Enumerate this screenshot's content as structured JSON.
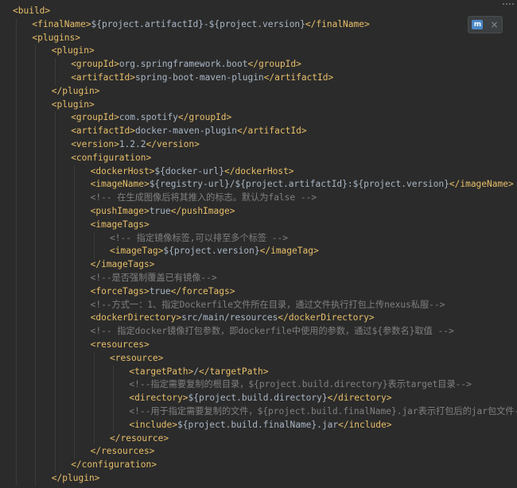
{
  "toolbar": {
    "maven_icon": "maven-reload-icon",
    "close_icon": "close-icon"
  },
  "code_lines": [
    {
      "indent": 0,
      "parts": [
        {
          "t": "tag",
          "v": "<build>"
        }
      ]
    },
    {
      "indent": 1,
      "parts": [
        {
          "t": "tag",
          "v": "<finalName>"
        },
        {
          "t": "txt",
          "v": "${project.artifactId}-${project.version}"
        },
        {
          "t": "tag",
          "v": "</finalName>"
        }
      ]
    },
    {
      "indent": 1,
      "parts": [
        {
          "t": "tag",
          "v": "<plugins>"
        }
      ]
    },
    {
      "indent": 2,
      "parts": [
        {
          "t": "tag",
          "v": "<plugin>"
        }
      ]
    },
    {
      "indent": 3,
      "parts": [
        {
          "t": "tag",
          "v": "<groupId>"
        },
        {
          "t": "txt",
          "v": "org.springframework.boot"
        },
        {
          "t": "tag",
          "v": "</groupId>"
        }
      ]
    },
    {
      "indent": 3,
      "parts": [
        {
          "t": "tag",
          "v": "<artifactId>"
        },
        {
          "t": "txt",
          "v": "spring-boot-maven-plugin"
        },
        {
          "t": "tag",
          "v": "</artifactId>"
        }
      ]
    },
    {
      "indent": 2,
      "parts": [
        {
          "t": "tag",
          "v": "</plugin>"
        }
      ]
    },
    {
      "indent": 2,
      "parts": [
        {
          "t": "tag",
          "v": "<plugin>"
        }
      ]
    },
    {
      "indent": 3,
      "parts": [
        {
          "t": "tag",
          "v": "<groupId>"
        },
        {
          "t": "txt",
          "v": "com.spotify"
        },
        {
          "t": "tag",
          "v": "</groupId>"
        }
      ]
    },
    {
      "indent": 3,
      "parts": [
        {
          "t": "tag",
          "v": "<artifactId>"
        },
        {
          "t": "txt",
          "v": "docker-maven-plugin"
        },
        {
          "t": "tag",
          "v": "</artifactId>"
        }
      ]
    },
    {
      "indent": 3,
      "parts": [
        {
          "t": "tag",
          "v": "<version>"
        },
        {
          "t": "txt",
          "v": "1.2.2"
        },
        {
          "t": "tag",
          "v": "</version>"
        }
      ]
    },
    {
      "indent": 3,
      "parts": [
        {
          "t": "tag",
          "v": "<configuration>"
        }
      ]
    },
    {
      "indent": 4,
      "parts": [
        {
          "t": "tag",
          "v": "<dockerHost>"
        },
        {
          "t": "txt",
          "v": "${docker-url}"
        },
        {
          "t": "tag",
          "v": "</dockerHost>"
        }
      ]
    },
    {
      "indent": 4,
      "parts": [
        {
          "t": "tag",
          "v": "<imageName>"
        },
        {
          "t": "txt",
          "v": "${registry-url}/${project.artifactId}:${project.version}"
        },
        {
          "t": "tag",
          "v": "</imageName>"
        }
      ]
    },
    {
      "indent": 4,
      "parts": [
        {
          "t": "cmt",
          "v": "<!-- 在生成图像后将其推入的标志。默认为false -->"
        }
      ]
    },
    {
      "indent": 4,
      "parts": [
        {
          "t": "tag",
          "v": "<pushImage>"
        },
        {
          "t": "txt",
          "v": "true"
        },
        {
          "t": "tag",
          "v": "</pushImage>"
        }
      ]
    },
    {
      "indent": 4,
      "parts": [
        {
          "t": "tag",
          "v": "<imageTags>"
        }
      ]
    },
    {
      "indent": 5,
      "parts": [
        {
          "t": "cmt",
          "v": "<!-- 指定镜像标签,可以排至多个标签 -->"
        }
      ]
    },
    {
      "indent": 5,
      "parts": [
        {
          "t": "tag",
          "v": "<imageTag>"
        },
        {
          "t": "txt",
          "v": "${project.version}"
        },
        {
          "t": "tag",
          "v": "</imageTag>"
        }
      ]
    },
    {
      "indent": 4,
      "parts": [
        {
          "t": "tag",
          "v": "</imageTags>"
        }
      ]
    },
    {
      "indent": 4,
      "parts": [
        {
          "t": "cmt",
          "v": "<!--是否强制覆盖已有镜像-->"
        }
      ]
    },
    {
      "indent": 4,
      "parts": [
        {
          "t": "tag",
          "v": "<forceTags>"
        },
        {
          "t": "txt",
          "v": "true"
        },
        {
          "t": "tag",
          "v": "</forceTags>"
        }
      ]
    },
    {
      "indent": 4,
      "parts": [
        {
          "t": "cmt",
          "v": "<!--方式一：1、指定Dockerfile文件所在目录，通过文件执行打包上传nexus私服-->"
        }
      ]
    },
    {
      "indent": 4,
      "parts": [
        {
          "t": "tag",
          "v": "<dockerDirectory>"
        },
        {
          "t": "txt",
          "v": "src/main/resources"
        },
        {
          "t": "tag",
          "v": "</dockerDirectory>"
        }
      ]
    },
    {
      "indent": 4,
      "parts": [
        {
          "t": "cmt",
          "v": "<!-- 指定docker镜像打包参数，即dockerfile中使用的参数，通过${参数名}取值 -->"
        }
      ]
    },
    {
      "indent": 4,
      "parts": [
        {
          "t": "tag",
          "v": "<resources>"
        }
      ]
    },
    {
      "indent": 5,
      "parts": [
        {
          "t": "tag",
          "v": "<resource>"
        }
      ]
    },
    {
      "indent": 6,
      "parts": [
        {
          "t": "tag",
          "v": "<targetPath>"
        },
        {
          "t": "txt",
          "v": "/"
        },
        {
          "t": "tag",
          "v": "</targetPath>"
        }
      ]
    },
    {
      "indent": 6,
      "parts": [
        {
          "t": "cmt",
          "v": "<!--指定需要复制的根目录，${project.build.directory}表示target目录-->"
        }
      ]
    },
    {
      "indent": 6,
      "parts": [
        {
          "t": "tag",
          "v": "<directory>"
        },
        {
          "t": "txt",
          "v": "${project.build.directory}"
        },
        {
          "t": "tag",
          "v": "</directory>"
        }
      ]
    },
    {
      "indent": 6,
      "parts": [
        {
          "t": "cmt",
          "v": "<!--用于指定需要复制的文件，${project.build.finalName}.jar表示打包后的jar包文件-->"
        }
      ]
    },
    {
      "indent": 6,
      "parts": [
        {
          "t": "tag",
          "v": "<include>"
        },
        {
          "t": "txt",
          "v": "${project.build.finalName}.jar"
        },
        {
          "t": "tag",
          "v": "</include>"
        }
      ]
    },
    {
      "indent": 5,
      "parts": [
        {
          "t": "tag",
          "v": "</resource>"
        }
      ]
    },
    {
      "indent": 4,
      "parts": [
        {
          "t": "tag",
          "v": "</resources>"
        }
      ]
    },
    {
      "indent": 3,
      "parts": [
        {
          "t": "tag",
          "v": "</configuration>"
        }
      ]
    },
    {
      "indent": 2,
      "parts": [
        {
          "t": "tag",
          "v": "</plugin>"
        }
      ]
    }
  ]
}
